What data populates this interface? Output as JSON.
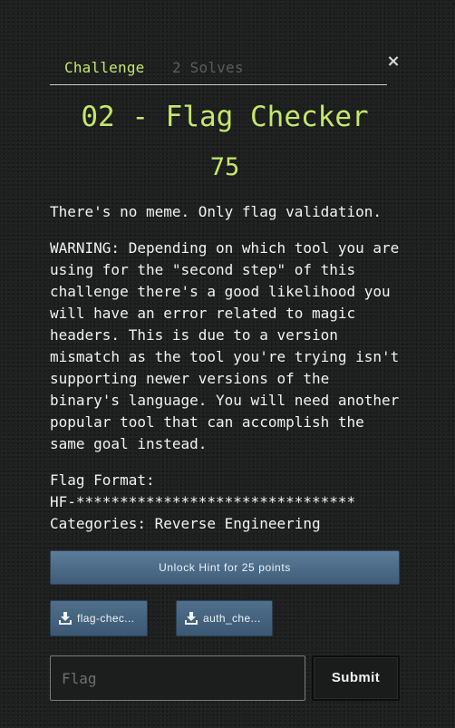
{
  "tabs": {
    "challenge": "Challenge",
    "solves": "2 Solves"
  },
  "close_symbol": "×",
  "challenge": {
    "title": "02 - Flag Checker",
    "points": "75",
    "description": "There's no meme. Only flag validation.",
    "warning_lines": [
      "WARNING: Depending on which tool you are",
      "using for the \"second step\" of this",
      "challenge there's a good likelihood you",
      "will have an error related to magic",
      "headers. This is due to a version",
      "mismatch as the tool you're trying isn't",
      "supporting newer versions of the",
      "binary's language. You will need another",
      "popular tool that can accomplish the",
      "same goal instead."
    ],
    "flag_format_label": "Flag Format:",
    "flag_format_value": "HF-********************************",
    "categories": "Categories: Reverse Engineering"
  },
  "hint_button": "Unlock Hint for 25 points",
  "files": [
    {
      "label": "flag-chec...",
      "icon": "download-icon"
    },
    {
      "label": "auth_che...",
      "icon": "download-icon"
    }
  ],
  "flag_input": {
    "placeholder": "Flag",
    "value": ""
  },
  "submit_label": "Submit",
  "colors": {
    "accent": "#c4e86b",
    "button": "#4f6f8b",
    "background": "#1e1f1f"
  }
}
